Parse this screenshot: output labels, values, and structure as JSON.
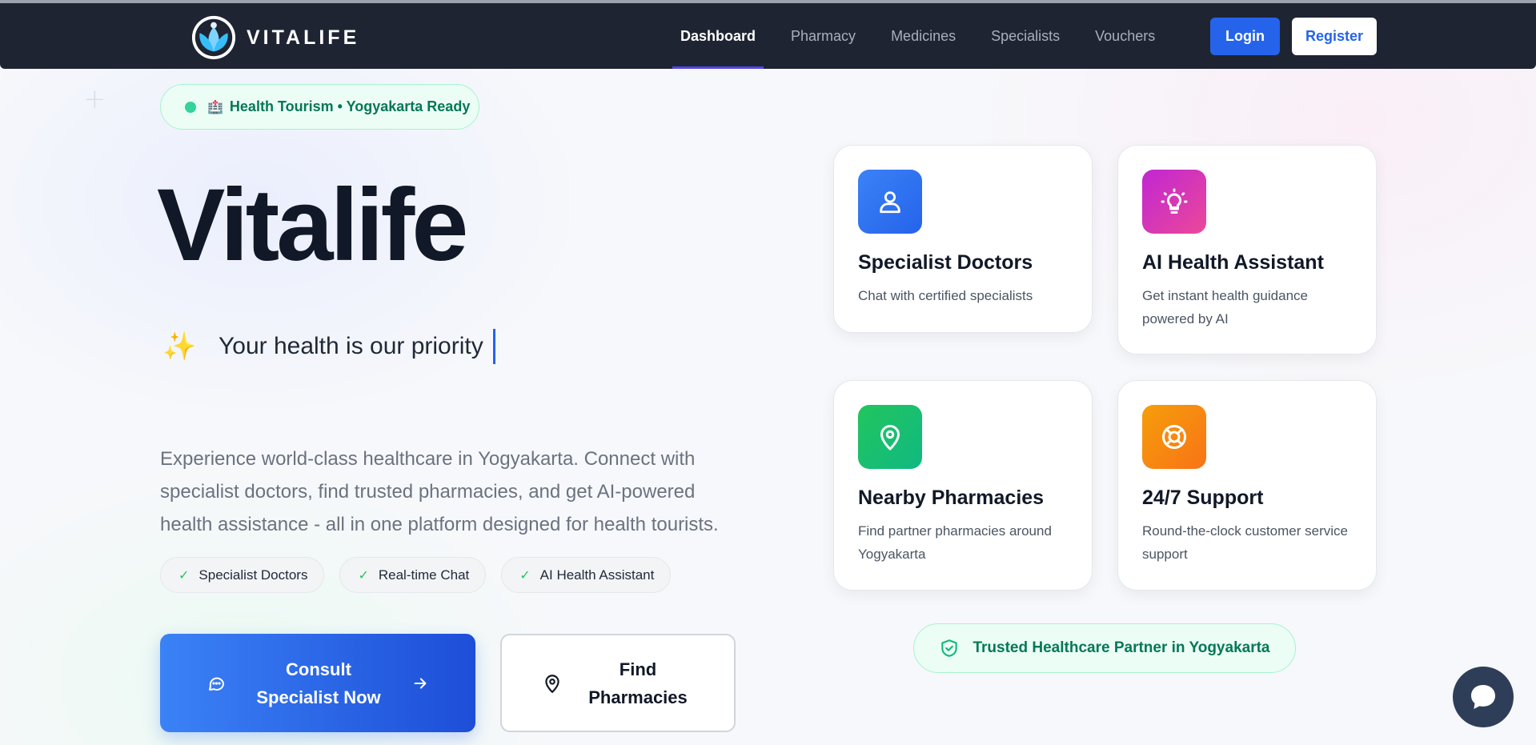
{
  "brand": {
    "name": "VITALIFE"
  },
  "nav": {
    "links": [
      {
        "label": "Dashboard",
        "active": true
      },
      {
        "label": "Pharmacy",
        "active": false
      },
      {
        "label": "Medicines",
        "active": false
      },
      {
        "label": "Specialists",
        "active": false
      },
      {
        "label": "Vouchers",
        "active": false
      }
    ],
    "login_label": "Login",
    "register_label": "Register"
  },
  "badge": {
    "emoji": "🏥",
    "text": "Health Tourism • Yogyakarta Ready"
  },
  "hero": {
    "title": "Vitalife",
    "tagline_icon": "✨",
    "tagline": "Your health is our priority",
    "description": "Experience world-class healthcare in Yogyakarta. Connect with specialist doctors, find trusted pharmacies, and get AI-powered health assistance - all in one platform designed for health tourists.",
    "features": [
      "Specialist Doctors",
      "Real-time Chat",
      "AI Health Assistant"
    ],
    "cta_primary": "Consult Specialist Now",
    "cta_secondary": "Find Pharmacies"
  },
  "cards": [
    {
      "title": "Specialist Doctors",
      "description": "Chat with certified specialists",
      "icon": "user-icon",
      "color": "#3b82f6"
    },
    {
      "title": "AI Health Assistant",
      "description": "Get instant health guidance powered by AI",
      "icon": "lightbulb-icon",
      "color": "#d946ef"
    },
    {
      "title": "Nearby Pharmacies",
      "description": "Find partner pharmacies around Yogyakarta",
      "icon": "map-pin-icon",
      "color": "#22c55e"
    },
    {
      "title": "24/7 Support",
      "description": "Round-the-clock customer service support",
      "icon": "lifebuoy-icon",
      "color": "#f59e0b"
    }
  ],
  "trust_badge": "Trusted Healthcare Partner in Yogyakarta",
  "colors": {
    "navbar": "#1e2432",
    "primary": "#2563eb",
    "success": "#047857",
    "accent_bar": "#4f46e5"
  }
}
